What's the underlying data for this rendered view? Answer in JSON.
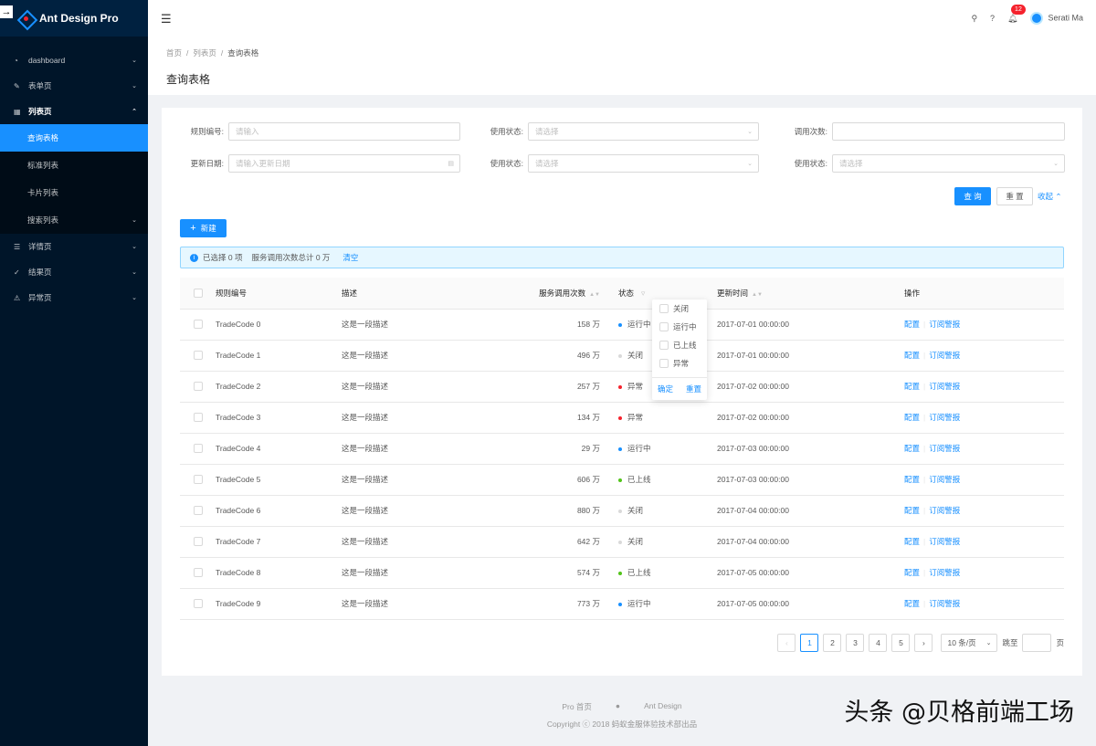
{
  "app": {
    "title": "Ant Design Pro"
  },
  "sidebar": {
    "items": [
      {
        "icon": "dashboard-icon",
        "label": "dashboard"
      },
      {
        "icon": "form-icon",
        "label": "表单页"
      },
      {
        "icon": "table-icon",
        "label": "列表页"
      },
      {
        "icon": "profile-icon",
        "label": "详情页"
      },
      {
        "icon": "check-circle-icon",
        "label": "结果页"
      },
      {
        "icon": "warning-icon",
        "label": "异常页"
      }
    ],
    "sub_items": [
      {
        "label": "查询表格"
      },
      {
        "label": "标准列表"
      },
      {
        "label": "卡片列表"
      },
      {
        "label": "搜索列表"
      }
    ]
  },
  "header": {
    "notification_count": "12",
    "user_name": "Serati Ma"
  },
  "breadcrumb": [
    "首页",
    "列表页",
    "查询表格"
  ],
  "page_title": "查询表格",
  "form": {
    "rule_no_label": "规则编号:",
    "rule_no_placeholder": "请输入",
    "status_label": "使用状态:",
    "status_placeholder": "请选择",
    "call_count_label": "调用次数:",
    "update_date_label": "更新日期:",
    "update_date_placeholder": "请输入更新日期",
    "status2_label": "使用状态:",
    "status2_placeholder": "请选择",
    "status3_label": "使用状态:",
    "status3_placeholder": "请选择",
    "query_button": "查 询",
    "reset_button": "重 置",
    "collapse_link": "收起"
  },
  "new_button": "新建",
  "alert": {
    "selected_text": "已选择 0 项",
    "total_text": "服务调用次数总计 0 万",
    "clear": "清空"
  },
  "table": {
    "columns": [
      "规则编号",
      "描述",
      "服务调用次数",
      "状态",
      "更新时间",
      "操作"
    ],
    "rows": [
      {
        "code": "TradeCode 0",
        "desc": "这是一段描述",
        "calls": "158 万",
        "status": "运行中",
        "color": "#1890ff",
        "time": "2017-07-01 00:00:00"
      },
      {
        "code": "TradeCode 1",
        "desc": "这是一段描述",
        "calls": "496 万",
        "status": "关闭",
        "color": "#d9d9d9",
        "time": "2017-07-01 00:00:00"
      },
      {
        "code": "TradeCode 2",
        "desc": "这是一段描述",
        "calls": "257 万",
        "status": "异常",
        "color": "#f5222d",
        "time": "2017-07-02 00:00:00"
      },
      {
        "code": "TradeCode 3",
        "desc": "这是一段描述",
        "calls": "134 万",
        "status": "异常",
        "color": "#f5222d",
        "time": "2017-07-02 00:00:00"
      },
      {
        "code": "TradeCode 4",
        "desc": "这是一段描述",
        "calls": "29 万",
        "status": "运行中",
        "color": "#1890ff",
        "time": "2017-07-03 00:00:00"
      },
      {
        "code": "TradeCode 5",
        "desc": "这是一段描述",
        "calls": "606 万",
        "status": "已上线",
        "color": "#52c41a",
        "time": "2017-07-03 00:00:00"
      },
      {
        "code": "TradeCode 6",
        "desc": "这是一段描述",
        "calls": "880 万",
        "status": "关闭",
        "color": "#d9d9d9",
        "time": "2017-07-04 00:00:00"
      },
      {
        "code": "TradeCode 7",
        "desc": "这是一段描述",
        "calls": "642 万",
        "status": "关闭",
        "color": "#d9d9d9",
        "time": "2017-07-04 00:00:00"
      },
      {
        "code": "TradeCode 8",
        "desc": "这是一段描述",
        "calls": "574 万",
        "status": "已上线",
        "color": "#52c41a",
        "time": "2017-07-05 00:00:00"
      },
      {
        "code": "TradeCode 9",
        "desc": "这是一段描述",
        "calls": "773 万",
        "status": "运行中",
        "color": "#1890ff",
        "time": "2017-07-05 00:00:00"
      }
    ],
    "action_config": "配置",
    "action_subscribe": "订阅警报"
  },
  "filter_dropdown": {
    "options": [
      "关闭",
      "运行中",
      "已上线",
      "异常"
    ],
    "confirm": "确定",
    "reset": "重置"
  },
  "pagination": {
    "pages": [
      "1",
      "2",
      "3",
      "4",
      "5"
    ],
    "current": "1",
    "page_size": "10 条/页",
    "jump_label": "跳至",
    "page_suffix": "页"
  },
  "footer": {
    "links": [
      "Pro 首页",
      "Ant Design"
    ],
    "copyright": "Copyright ⓒ 2018 蚂蚁金服体验技术部出品"
  },
  "watermark": "头条 @贝格前端工场"
}
